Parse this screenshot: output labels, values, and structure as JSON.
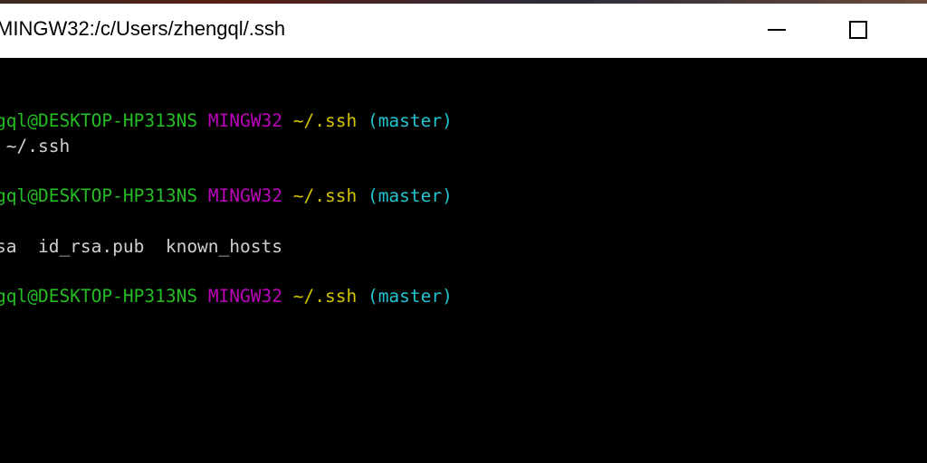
{
  "window": {
    "title": "MINGW32:/c/Users/zhengql/.ssh"
  },
  "terminal": {
    "lines": [
      {
        "user_host": "gql@DESKTOP-HP313NS",
        "system": "MINGW32",
        "path": "~/.ssh",
        "branch": "(master)"
      },
      {
        "text": " ~/.ssh"
      },
      {
        "user_host": "gql@DESKTOP-HP313NS",
        "system": "MINGW32",
        "path": "~/.ssh",
        "branch": "(master)"
      },
      {
        "text": "sa  id_rsa.pub  known_hosts"
      },
      {
        "user_host": "gql@DESKTOP-HP313NS",
        "system": "MINGW32",
        "path": "~/.ssh",
        "branch": "(master)"
      }
    ]
  },
  "colors": {
    "user_host": "#25bc24",
    "system": "#bc00bc",
    "path": "#d4c400",
    "branch": "#23c3d0",
    "text": "#d0d0d0",
    "background": "#000000"
  },
  "icons": {
    "minimize": "minimize-icon",
    "maximize": "maximize-icon"
  }
}
